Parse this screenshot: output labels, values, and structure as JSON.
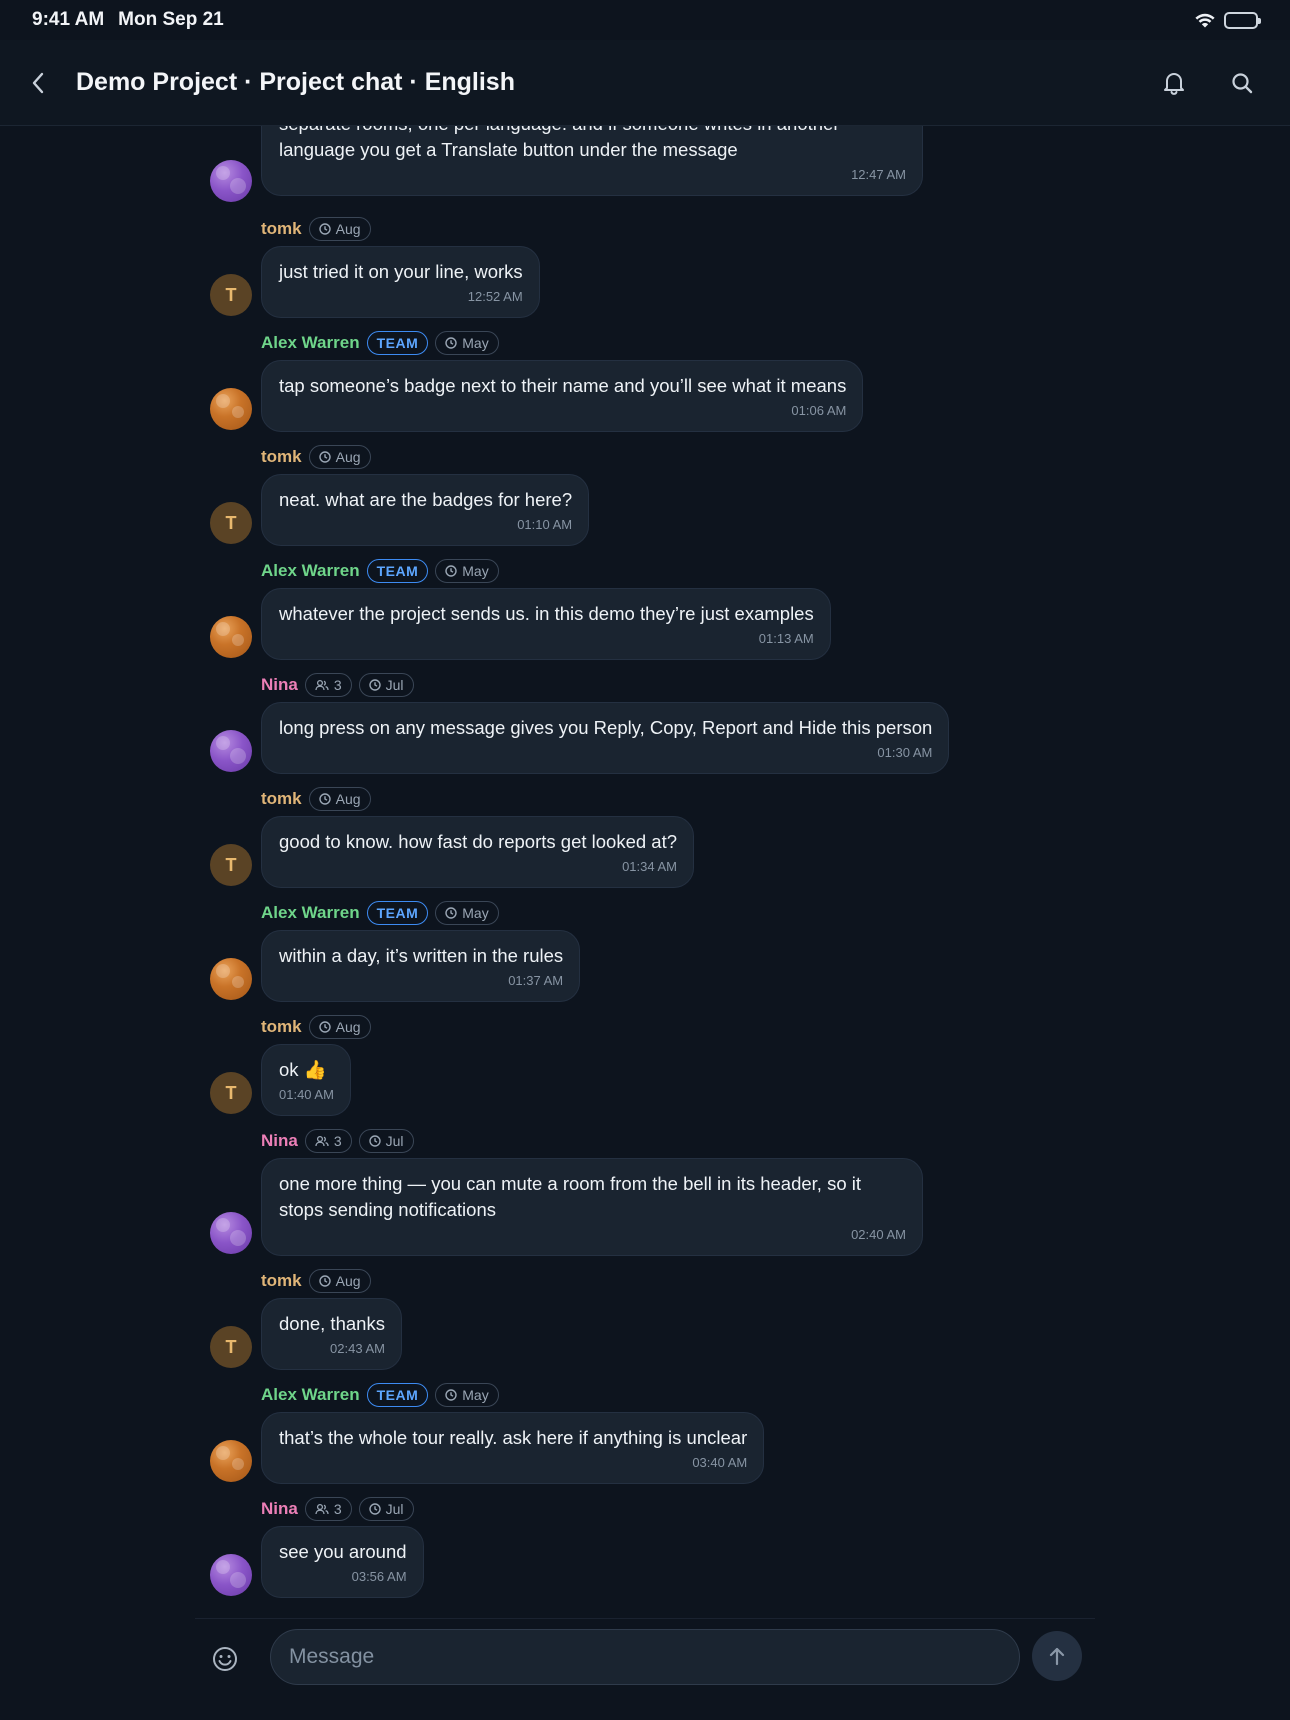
{
  "status_bar": {
    "time": "9:41 AM",
    "date": "Mon Sep 21"
  },
  "header": {
    "title": "Demo Project · Project chat · English"
  },
  "composer": {
    "placeholder": "Message"
  },
  "messages": [
    {
      "text": "separate rooms, one per language. and if someone writes in another language you get a Translate button under the message",
      "time": "12:47 AM"
    },
    {
      "name": "tomk",
      "chip_month": "Aug",
      "text": "just tried it on your line, works",
      "time": "12:52 AM"
    },
    {
      "name": "Alex Warren",
      "team_label": "TEAM",
      "chip_month": "May",
      "text": "tap someone’s badge next to their name and you’ll see what it means",
      "time": "01:06 AM"
    },
    {
      "name": "tomk",
      "chip_month": "Aug",
      "text": "neat. what are the badges for here?",
      "time": "01:10 AM"
    },
    {
      "name": "Alex Warren",
      "team_label": "TEAM",
      "chip_month": "May",
      "text": "whatever the project sends us. in this demo they’re just examples",
      "time": "01:13 AM"
    },
    {
      "name": "Nina",
      "people_count": "3",
      "chip_month": "Jul",
      "text": "long press on any message gives you Reply, Copy, Report and Hide this person",
      "time": "01:30 AM"
    },
    {
      "name": "tomk",
      "chip_month": "Aug",
      "text": "good to know. how fast do reports get looked at?",
      "time": "01:34 AM"
    },
    {
      "name": "Alex Warren",
      "team_label": "TEAM",
      "chip_month": "May",
      "text": "within a day, it’s written in the rules",
      "time": "01:37 AM"
    },
    {
      "name": "tomk",
      "chip_month": "Aug",
      "text": "ok 👍",
      "time": "01:40 AM"
    },
    {
      "name": "Nina",
      "people_count": "3",
      "chip_month": "Jul",
      "text": "one more thing — you can mute a room from the bell in its header, so it stops sending notifications",
      "time": "02:40 AM"
    },
    {
      "name": "tomk",
      "chip_month": "Aug",
      "text": "done, thanks",
      "time": "02:43 AM"
    },
    {
      "name": "Alex Warren",
      "team_label": "TEAM",
      "chip_month": "May",
      "text": "that’s the whole tour really. ask here if anything is unclear",
      "time": "03:40 AM"
    },
    {
      "name": "Nina",
      "people_count": "3",
      "chip_month": "Jul",
      "text": "see you around",
      "time": "03:56 AM"
    }
  ],
  "avatars": {
    "tomk_initial": "T"
  }
}
